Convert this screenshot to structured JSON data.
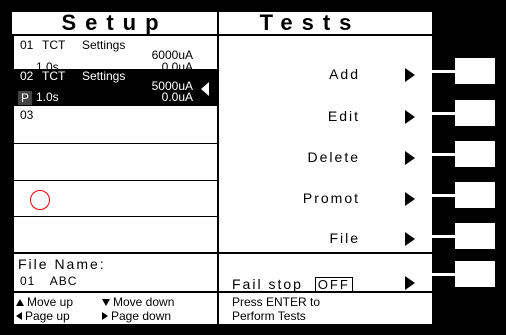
{
  "header": {
    "setup_title": "Setup",
    "tests_title": "Tests"
  },
  "slots": [
    {
      "num": "01",
      "mode": "TCT",
      "settings": "Settings",
      "val1": "6000uA",
      "time": "1.0s",
      "val2": "0.0uA",
      "selected": false
    },
    {
      "num": "02",
      "mode": "TCT",
      "settings": "Settings",
      "val1": "5000uA",
      "time": "1.0s",
      "val2": "0.0uA",
      "badge": "P",
      "selected": true
    },
    {
      "num": "03"
    }
  ],
  "file": {
    "label": "File Name:",
    "num": "01",
    "name": "ABC"
  },
  "menu": {
    "add": "Add",
    "edit": "Edit",
    "delete": "Delete",
    "promot": "Promot",
    "file": "File",
    "fail_stop": "Fail stop",
    "fail_stop_value": "OFF"
  },
  "footer": {
    "move_up": "Move up",
    "move_down": "Move down",
    "page_up": "Page up",
    "page_down": "Page down",
    "press_enter": "Press  ENTER  to",
    "perform": "Perform Tests"
  },
  "colors": {
    "background": "#000000",
    "screen": "#ffffff",
    "marker": "#e00000"
  }
}
